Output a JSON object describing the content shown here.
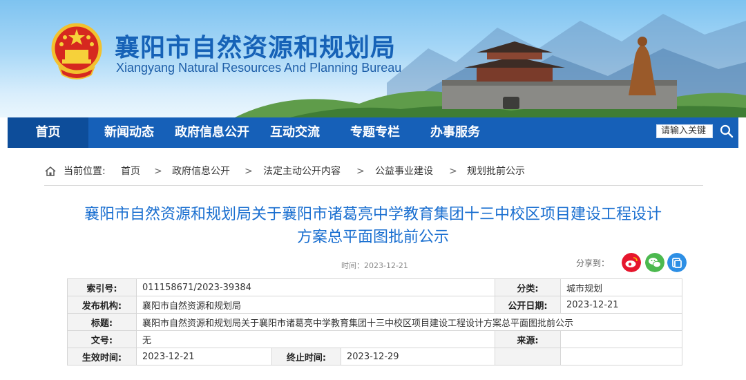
{
  "header": {
    "title": "襄阳市自然资源和规划局",
    "subtitle": "Xiangyang Natural Resources And Planning Bureau",
    "emblem_icon": "national-emblem",
    "colors": {
      "title": "#1662b7",
      "nav": "#1660b8",
      "nav_active": "#0d4d9a"
    }
  },
  "nav": {
    "items": [
      "首页",
      "新闻动态",
      "政府信息公开",
      "互动交流",
      "专题专栏",
      "办事服务"
    ],
    "search_placeholder": "请输入关键",
    "search_icon": "search-icon"
  },
  "breadcrumb": {
    "prefix": "当前位置:",
    "items": [
      "首页",
      "政府信息公开",
      "法定主动公开内容",
      "公益事业建设",
      "规划批前公示"
    ],
    "separator": ">"
  },
  "article": {
    "title_line1": "襄阳市自然资源和规划局关于襄阳市诸葛亮中学教育集团十三中校区项目建设工程设计",
    "title_line2": "方案总平面图批前公示",
    "time": "时间：2023-12-21",
    "share_label": "分享到：",
    "share_icons": [
      "weibo-icon",
      "wechat-icon",
      "qzone-icon"
    ],
    "share_colors": {
      "weibo": "#e6162d",
      "wechat": "#4cb94f",
      "qzone": "#2d8fe5"
    }
  },
  "info": {
    "index_label": "索引号:",
    "index_value": "011158671/2023-39384",
    "category_label": "分类:",
    "category_value": "城市规划",
    "publisher_label": "发布机构:",
    "publisher_value": "襄阳市自然资源和规划局",
    "date_label": "公开日期:",
    "date_value": "2023-12-21",
    "subject_label": "标题:",
    "subject_value": "襄阳市自然资源和规划局关于襄阳市诸葛亮中学教育集团十三中校区项目建设工程设计方案总平面图批前公示",
    "docno_label": "文号:",
    "docno_value": "无",
    "source_label": "来源:",
    "source_value": "",
    "effective_label": "生效时间:",
    "effective_value": "2023-12-21",
    "end_label": "终止时间:",
    "end_value": "2023-12-29"
  }
}
